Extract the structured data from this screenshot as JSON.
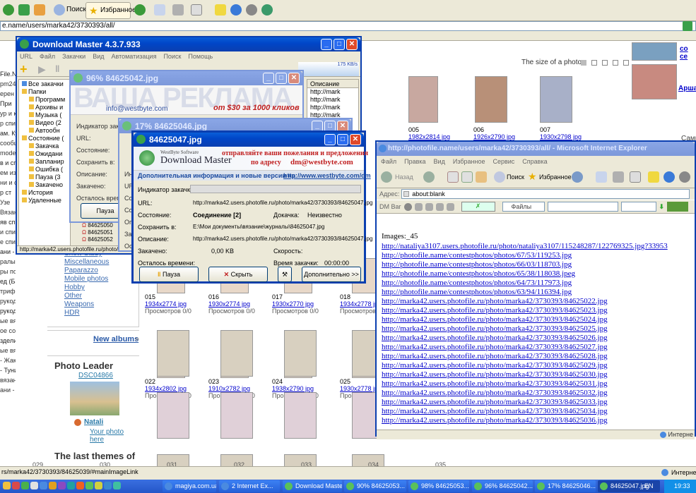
{
  "ie_main": {
    "toolbar": {
      "search": "Поиск",
      "favorites": "Избранное"
    },
    "address": "e.name/users/marka42/3730393/all/",
    "status": "rs/marka42/3730393/84625039/#mainImageLink",
    "status_zone": "Интернет"
  },
  "left_text": [
    "File.N",
    "рm24",
    "ерен к",
    "При",
    "ур и кр",
    "р спицам",
    "ам. Кур",
    "сообщ",
    "modeli-",
    "в и спиц",
    "ем из",
    "ни и спи",
    "р ст",
    "Узе",
    "Вязан",
    "яв спиц",
    "и спиц",
    "е спиц",
    "ани - Главен",
    "ралы по",
    "ры по",
    "ед (Батик",
    "трифы и ша",
    "рукодели",
    "рукодели",
    "ые вязани",
    "ое сохран",
    "зделия",
    "ые вязаны",
    "- Жакет",
    "- Туника",
    "вязание",
    "ани - Ка"
  ],
  "page": {
    "size_label": "The size of a photo:",
    "nav_links": [
      "Show Study",
      "Miscellaneous",
      "Paparazzo",
      "Mobile photos",
      "Hobby",
      "Other",
      "Weapons",
      "HDR"
    ],
    "new_albums": "New albums",
    "photo_leader": "Photo Leader",
    "leader_name": "DSC04866",
    "leader_user": "Natali",
    "your_photo": "Your photo here",
    "last_themes": "The last themes of",
    "side_link": "со се",
    "side_link2": "Арша",
    "side_text": "Самь",
    "thumbs_top": [
      {
        "n": "005",
        "s": "1982x2814 jpg"
      },
      {
        "n": "006",
        "s": "1926x2790 jpg"
      },
      {
        "n": "007",
        "s": "1930x2798 jpg"
      }
    ],
    "thumbs_rows": [
      [
        {
          "n": "015",
          "s": "1934x2774 jpg"
        },
        {
          "n": "016",
          "s": "1930x2774 jpg"
        },
        {
          "n": "017",
          "s": "1930x2770 jpg"
        },
        {
          "n": "018",
          "s": "1934x2778 jpg"
        }
      ],
      [
        {
          "n": "022",
          "s": "1934x2802 jpg"
        },
        {
          "n": "023",
          "s": "1910x2782 jpg"
        },
        {
          "n": "024",
          "s": "1938x2790 jpg"
        },
        {
          "n": "025",
          "s": "1930x2778 jpg"
        }
      ]
    ],
    "views": "Просмотров 0/0",
    "bottom_nums": [
      "029",
      "030",
      "031",
      "032",
      "033",
      "034",
      "035"
    ]
  },
  "dm_main": {
    "title": "Download Master 4.3.7.933",
    "menu": [
      "URL",
      "Файл",
      "Закачки",
      "Вид",
      "Автоматизация",
      "Поиск",
      "Помощь"
    ],
    "speed": "175 KB/s",
    "tree": [
      "Все закачки",
      "Папки",
      "Программ",
      "Архивы и",
      "Музыка (",
      "Видео (2",
      "Автообн",
      "Состояние (",
      "Закачка",
      "Ожидани",
      "Запланир",
      "Ошибка (",
      "Пауза (3",
      "Закачено",
      "История",
      "Удаленные"
    ],
    "desc_header": "Описание",
    "desc_items": [
      "http://mark",
      "http://mark",
      "http://mark",
      "http://mark",
      "http://mark",
      "http://mark",
      "http://mark"
    ],
    "files": [
      "84625050",
      "84625051",
      "84625052"
    ],
    "status": "http://marka42.users.photofile.ru/photo/m"
  },
  "dm2": {
    "title": "96% 84625042.jpg",
    "banner": "ВАША РЕКЛАМА",
    "email": "info@westbyte.com",
    "promo": "от $30 за 1000 кликов",
    "labels": [
      "Индикатор закачки:",
      "URL:",
      "Состояние:",
      "Сохранить в:",
      "Описание:",
      "Закачено:",
      "Осталось времен"
    ],
    "pause": "Пауза"
  },
  "dm3": {
    "title": "17% 84625046.jpg",
    "labels": [
      "Индикатор",
      "URL",
      "Сост",
      "Сохр",
      "Опи",
      "Зак",
      "Ост"
    ]
  },
  "dm4": {
    "title": "84625047.jpg",
    "brand_small": "WestByte Software",
    "brand": "Download Master",
    "promo1": "отправляйте ваши пожелания и предложения",
    "promo2": "по адресу",
    "promo_email": "dm@westbyte.com",
    "info": "Дополнительная информация и новые версии на:",
    "info_link": "http://www.westbyte.com/dm",
    "lbl_indicator": "Индикатор закачки:",
    "lbl_url": "URL:",
    "url": "http://marka42.users.photofile.ru/photo/marka42/3730393/84625047.jpg",
    "lbl_state": "Состояние:",
    "state": "Соединение [2]",
    "lbl_resume": "Докачка:",
    "resume": "Неизвестно",
    "lbl_save": "Сохранить в:",
    "save": "E:\\Мои документы\\вязание\\журналы\\84625047.jpg",
    "lbl_desc": "Описание:",
    "desc": "http://marka42.users.photofile.ru/photo/marka42/3730393/84625047.jpg",
    "lbl_done": "Закачено:",
    "done": "0,00 KB",
    "lbl_speed": "Скорость:",
    "speed": "",
    "lbl_left": "Осталось времени:",
    "lbl_time": "Время закачки:",
    "time": "00:00:00",
    "btn_pause": "Пауза",
    "btn_hide": "Скрыть",
    "btn_more": "Дополнительно >>"
  },
  "ie2": {
    "title": "http://photofile.name/users/marka42/3730393/all/ - Microsoft Internet Explorer",
    "menu": [
      "Файл",
      "Правка",
      "Вид",
      "Избранное",
      "Сервис",
      "Справка"
    ],
    "back": "Назад",
    "search": "Поиск",
    "favorites": "Избранное",
    "address_label": "Адрес:",
    "address": "about:blank",
    "dmbar": "DM Bar",
    "files": "Файлы",
    "images_label": "Images:_45",
    "links": [
      "http://nataliya3107.users.photofile.ru/photo/nataliya3107/115248287/122769325.jpg?33953",
      "http://photofile.name/contestphotos/photos/67/53/119253.jpg",
      "http://photofile.name/contestphotos/photos/66/03/118703.jpg",
      "http://photofile.name/contestphotos/photos/65/38/118038.jpeg",
      "http://photofile.name/contestphotos/photos/64/73/117973.jpg",
      "http://photofile.name/contestphotos/photos/63/94/116394.jpg",
      "http://marka42.users.photofile.ru/photo/marka42/3730393/84625022.jpg",
      "http://marka42.users.photofile.ru/photo/marka42/3730393/84625023.jpg",
      "http://marka42.users.photofile.ru/photo/marka42/3730393/84625024.jpg",
      "http://marka42.users.photofile.ru/photo/marka42/3730393/84625025.jpg",
      "http://marka42.users.photofile.ru/photo/marka42/3730393/84625026.jpg",
      "http://marka42.users.photofile.ru/photo/marka42/3730393/84625027.jpg",
      "http://marka42.users.photofile.ru/photo/marka42/3730393/84625028.jpg",
      "http://marka42.users.photofile.ru/photo/marka42/3730393/84625029.jpg",
      "http://marka42.users.photofile.ru/photo/marka42/3730393/84625030.jpg",
      "http://marka42.users.photofile.ru/photo/marka42/3730393/84625031.jpg",
      "http://marka42.users.photofile.ru/photo/marka42/3730393/84625032.jpg",
      "http://marka42.users.photofile.ru/photo/marka42/3730393/84625033.jpg",
      "http://marka42.users.photofile.ru/photo/marka42/3730393/84625034.jpg",
      "http://marka42.users.photofile.ru/photo/marka42/3730393/84625036.jpg"
    ],
    "status": "Интерне"
  },
  "taskbar": {
    "items": [
      "magiya.com.ua...",
      "2 Internet Ex...",
      "Download Master",
      "90% 84625053...",
      "98% 84625053...",
      "96% 84625042...",
      "17% 84625046...",
      "84625047.jpg"
    ],
    "lang": "EN",
    "clock": "19:33"
  }
}
